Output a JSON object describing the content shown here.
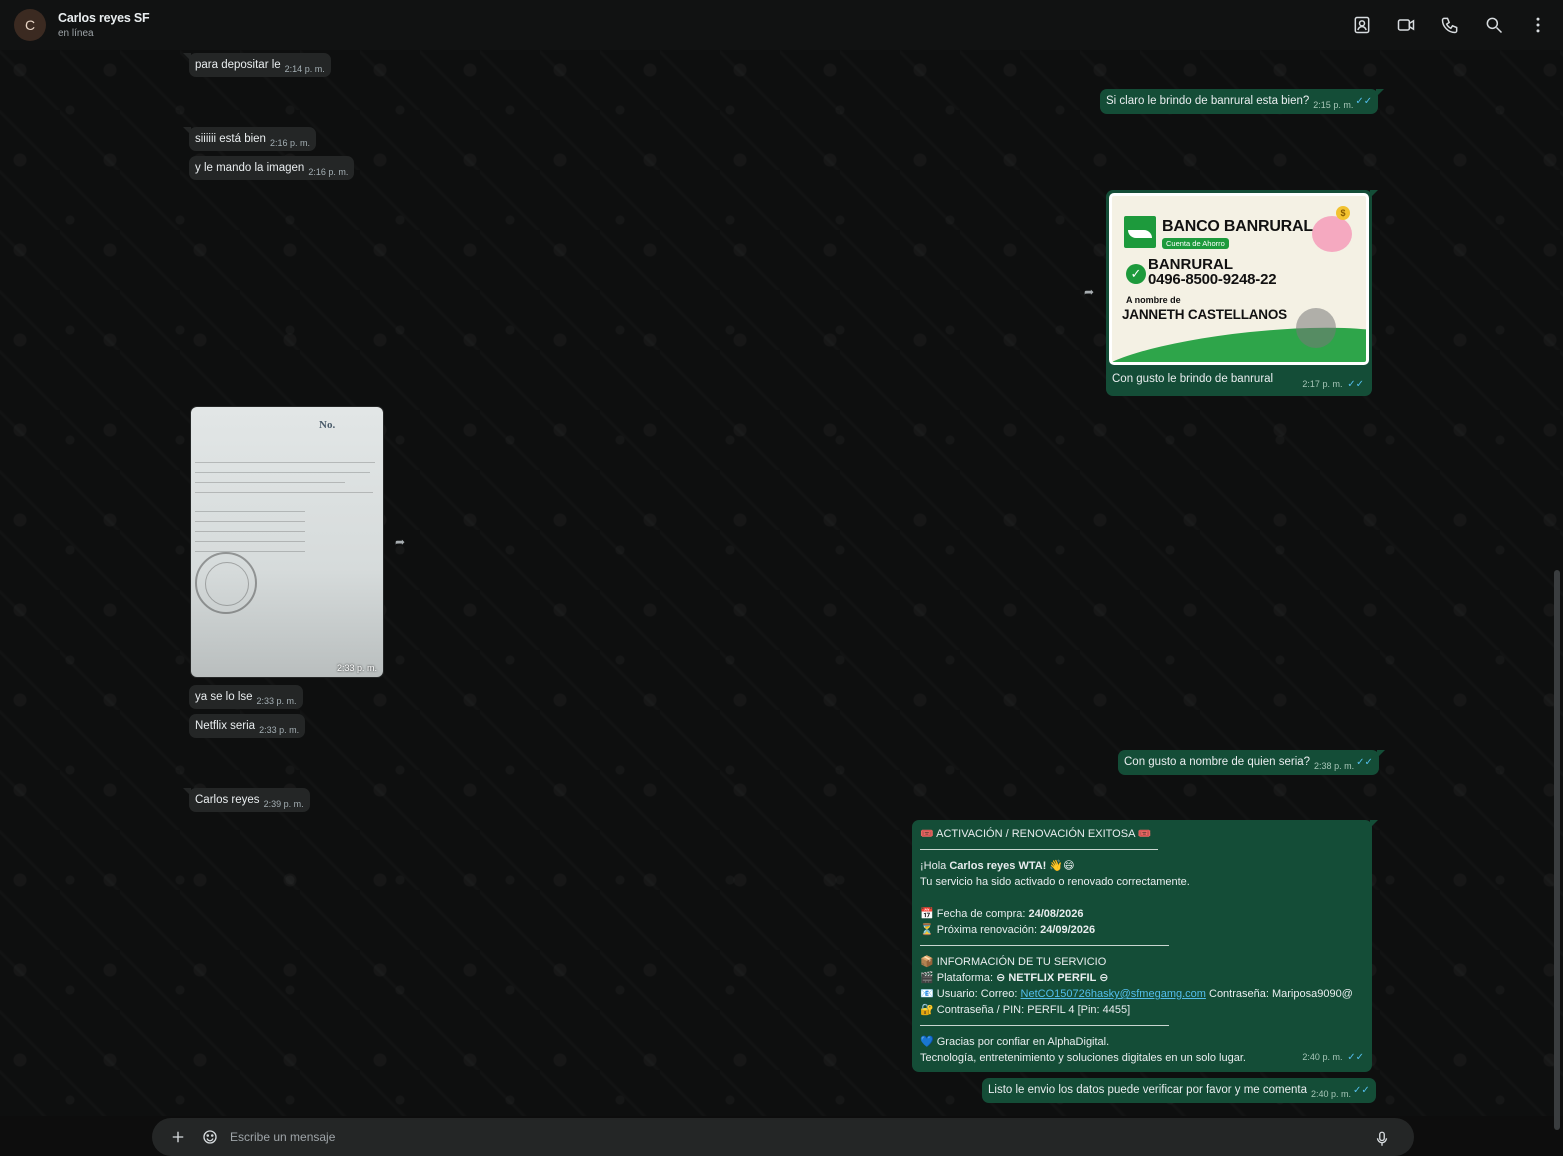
{
  "header": {
    "avatar_initial": "C",
    "contact_name": "Carlos reyes SF",
    "status": "en línea",
    "icons": [
      "contacts-icon",
      "video-call-icon",
      "phone-icon",
      "search-icon",
      "more-icon"
    ]
  },
  "messages": [
    {
      "dir": "in",
      "text": "para depositar le",
      "time": "2:14 p. m."
    },
    {
      "dir": "out",
      "text": "Si claro le brindo de banrural esta bien?",
      "time": "2:15 p. m."
    },
    {
      "dir": "in",
      "text": "siiiiii está bien",
      "time": "2:16 p. m."
    },
    {
      "dir": "in",
      "text": "y le mando la imagen",
      "time": "2:16 p. m."
    },
    {
      "dir": "out",
      "type": "image",
      "caption": "Con gusto le brindo de banrural",
      "time": "2:17 p. m."
    },
    {
      "dir": "in",
      "type": "image",
      "time": "2:33 p. m."
    },
    {
      "dir": "in",
      "text": "ya se lo lse",
      "time": "2:33 p. m."
    },
    {
      "dir": "in",
      "text": "Netflix seria",
      "time": "2:33 p. m."
    },
    {
      "dir": "out",
      "text": "Con gusto a nombre de quien seria?",
      "time": "2:38 p. m."
    },
    {
      "dir": "in",
      "text": "Carlos reyes",
      "time": "2:39 p. m."
    },
    {
      "dir": "out",
      "text": "Listo le envio los datos puede verificar por favor y me comenta",
      "time": "2:40 p. m."
    }
  ],
  "bank_image": {
    "bank_name": "BANCO BANRURAL",
    "account_type": "Cuenta de Ahorro",
    "account_label": "BANRURAL",
    "account_number": "0496-8500-9248-22",
    "owner_label": "A nombre de",
    "owner_name": "JANNETH CASTELLANOS",
    "coin_symbol": "$"
  },
  "receipt_image": {
    "number_label": "No."
  },
  "activation": {
    "title": "🎟️ ACTIVACIÓN / RENOVACIÓN EXITOSA 🎟️",
    "greeting_prefix": "¡Hola ",
    "greeting_name": "Carlos reyes WTA!",
    "greeting_suffix": " 👋😄",
    "line_activated": "Tu servicio ha sido activado o renovado correctamente.",
    "purchase_label": "📅 Fecha de compra: ",
    "purchase_date": "24/08/2026",
    "renewal_label": "⏳ Próxima renovación: ",
    "renewal_date": "24/09/2026",
    "info_title": "📦 INFORMACIÓN DE TU SERVICIO",
    "platform_label": "🎬 Plataforma: ",
    "platform_value": "⊖ NETFLIX PERFIL ⊖",
    "user_label": "📧 Usuario: Correo: ",
    "user_email": "NetCO150726hasky@sfmegamg.com",
    "user_password": " Contraseña: Mariposa9090@",
    "pin_line": "🔐 Contraseña / PIN: PERFIL 4 [Pin: 4455]",
    "thanks": "💙 Gracias por confiar en AlphaDigital.",
    "tagline": "Tecnología, entretenimiento y soluciones digitales en un solo lugar.",
    "time": "2:40 p. m."
  },
  "composer": {
    "placeholder": "Escribe un mensaje"
  },
  "colors": {
    "incoming_bubble": "#242626",
    "outgoing_bubble": "#144d37",
    "read_ticks": "#53bdeb"
  }
}
